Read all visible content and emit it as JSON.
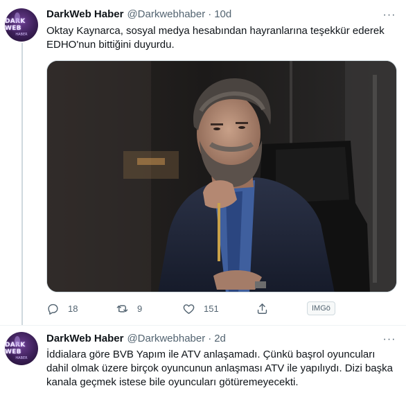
{
  "tweets": [
    {
      "display_name": "DarkWeb Haber",
      "handle": "@Darkwebhaber",
      "separator": "·",
      "time": "10d",
      "text": "Oktay Kaynarca, sosyal medya hesabından hayranlarına teşekkür ederek EDHO'nun bittiğini duyurdu.",
      "avatar_text": "DARK WEB",
      "avatar_subtext": "HABER",
      "more_glyph": "···",
      "actions": {
        "replies": "18",
        "retweets": "9",
        "likes": "151"
      },
      "badge": "IMGö"
    },
    {
      "display_name": "DarkWeb Haber",
      "handle": "@Darkwebhaber",
      "separator": "·",
      "time": "2d",
      "text": "İddialara göre BVB Yapım ile ATV anlaşamadı. Çünkü başrol oyuncuları dahil olmak üzere birçok oyuncunun anlaşması ATV ile yapılıydı. Dizi başka kanala geçmek istese bile oyuncuları götüremeyecekti.",
      "avatar_text": "DARK WEB",
      "avatar_subtext": "HABER",
      "more_glyph": "···"
    }
  ],
  "colors": {
    "text_primary": "#0f1419",
    "text_secondary": "#536471",
    "border": "#cfd9de",
    "avatar_purple": "#3b1f57"
  },
  "icons": [
    "reply-icon",
    "retweet-icon",
    "like-icon",
    "share-icon",
    "more-icon"
  ]
}
